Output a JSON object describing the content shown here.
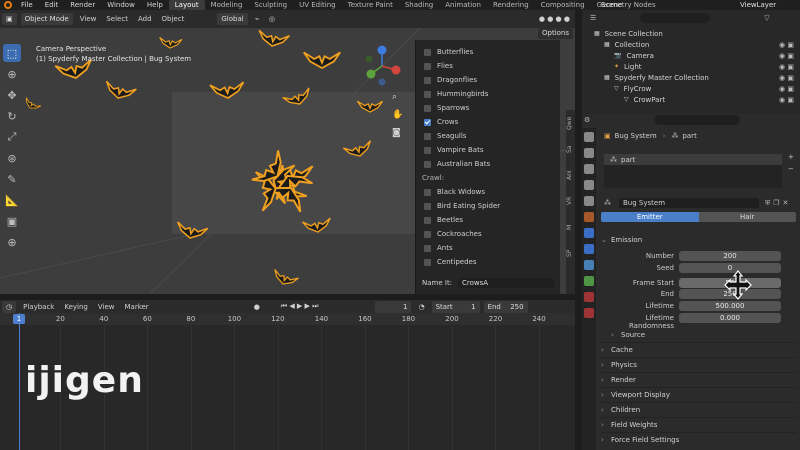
{
  "app": {
    "menu": [
      "File",
      "Edit",
      "Render",
      "Window",
      "Help"
    ],
    "workspaces": [
      "Layout",
      "Modeling",
      "Sculpting",
      "UV Editing",
      "Texture Paint",
      "Shading",
      "Animation",
      "Rendering",
      "Compositing",
      "Geometry Nodes"
    ],
    "active_workspace": "Layout",
    "scene": "Scene",
    "view_layer": "ViewLayer"
  },
  "viewport": {
    "mode": "Object Mode",
    "menus": [
      "View",
      "Select",
      "Add",
      "Object"
    ],
    "transform": "Global",
    "camera_label": "Camera Perspective",
    "collection_label": "(1) Spyderfy Master Collection | Bug System",
    "options_label": "Options"
  },
  "dropdown": {
    "items_top": [
      "Butterflies",
      "Flies",
      "Dragonflies",
      "Hummingbirds",
      "Sparrows",
      "Crows",
      "Seagulls",
      "Vampire Bats",
      "Australian Bats"
    ],
    "checked": "Crows",
    "section": "Crawl:",
    "items_crawl": [
      "Black Widows",
      "Bird Eating Spider",
      "Beetles",
      "Cockroaches",
      "Ants",
      "Centipedes"
    ],
    "name_label": "Name It:",
    "name_value": "CrowsA"
  },
  "ntabs": [
    "Qwe",
    "Sa",
    "Ani",
    "VR",
    "M",
    "SP"
  ],
  "timeline": {
    "menus": [
      "Playback",
      "Keying",
      "View",
      "Marker"
    ],
    "current_frame": "1",
    "start_label": "Start",
    "start": "1",
    "end_label": "End",
    "end": "250",
    "ticks": [
      "1",
      "20",
      "40",
      "60",
      "80",
      "100",
      "120",
      "140",
      "160",
      "180",
      "200",
      "220",
      "240"
    ],
    "watermark": "ijigen"
  },
  "outliner": {
    "rows": [
      {
        "label": "Scene Collection",
        "indent": 0
      },
      {
        "label": "Collection",
        "indent": 1
      },
      {
        "label": "Camera",
        "indent": 2
      },
      {
        "label": "Light",
        "indent": 2
      },
      {
        "label": "Spyderfy Master Collection",
        "indent": 1
      },
      {
        "label": "FlyCrow",
        "indent": 2
      },
      {
        "label": "CrowPart",
        "indent": 3
      }
    ]
  },
  "properties": {
    "breadcrumb_obj": "Bug System",
    "breadcrumb_sys": "part",
    "psys_item": "part",
    "settings_name": "Bug System",
    "tab_emitter": "Emitter",
    "tab_hair": "Hair",
    "emission_label": "Emission",
    "fields": [
      {
        "label": "Number",
        "value": "200"
      },
      {
        "label": "Seed",
        "value": "0"
      },
      {
        "label": "Frame Start",
        "value": "50"
      },
      {
        "label": "End",
        "value": "250"
      },
      {
        "label": "Lifetime",
        "value": "500.000"
      },
      {
        "label": "Lifetime Randomness",
        "value": "0.000"
      }
    ],
    "source_label": "Source",
    "panels": [
      "Cache",
      "Physics",
      "Render",
      "Viewport Display",
      "Children",
      "Field Weights",
      "Force Field Settings"
    ]
  },
  "colors": {
    "accent": "#4a7ec9",
    "crow_outline": "#f0a020",
    "playhead": "#4d7fd0"
  }
}
